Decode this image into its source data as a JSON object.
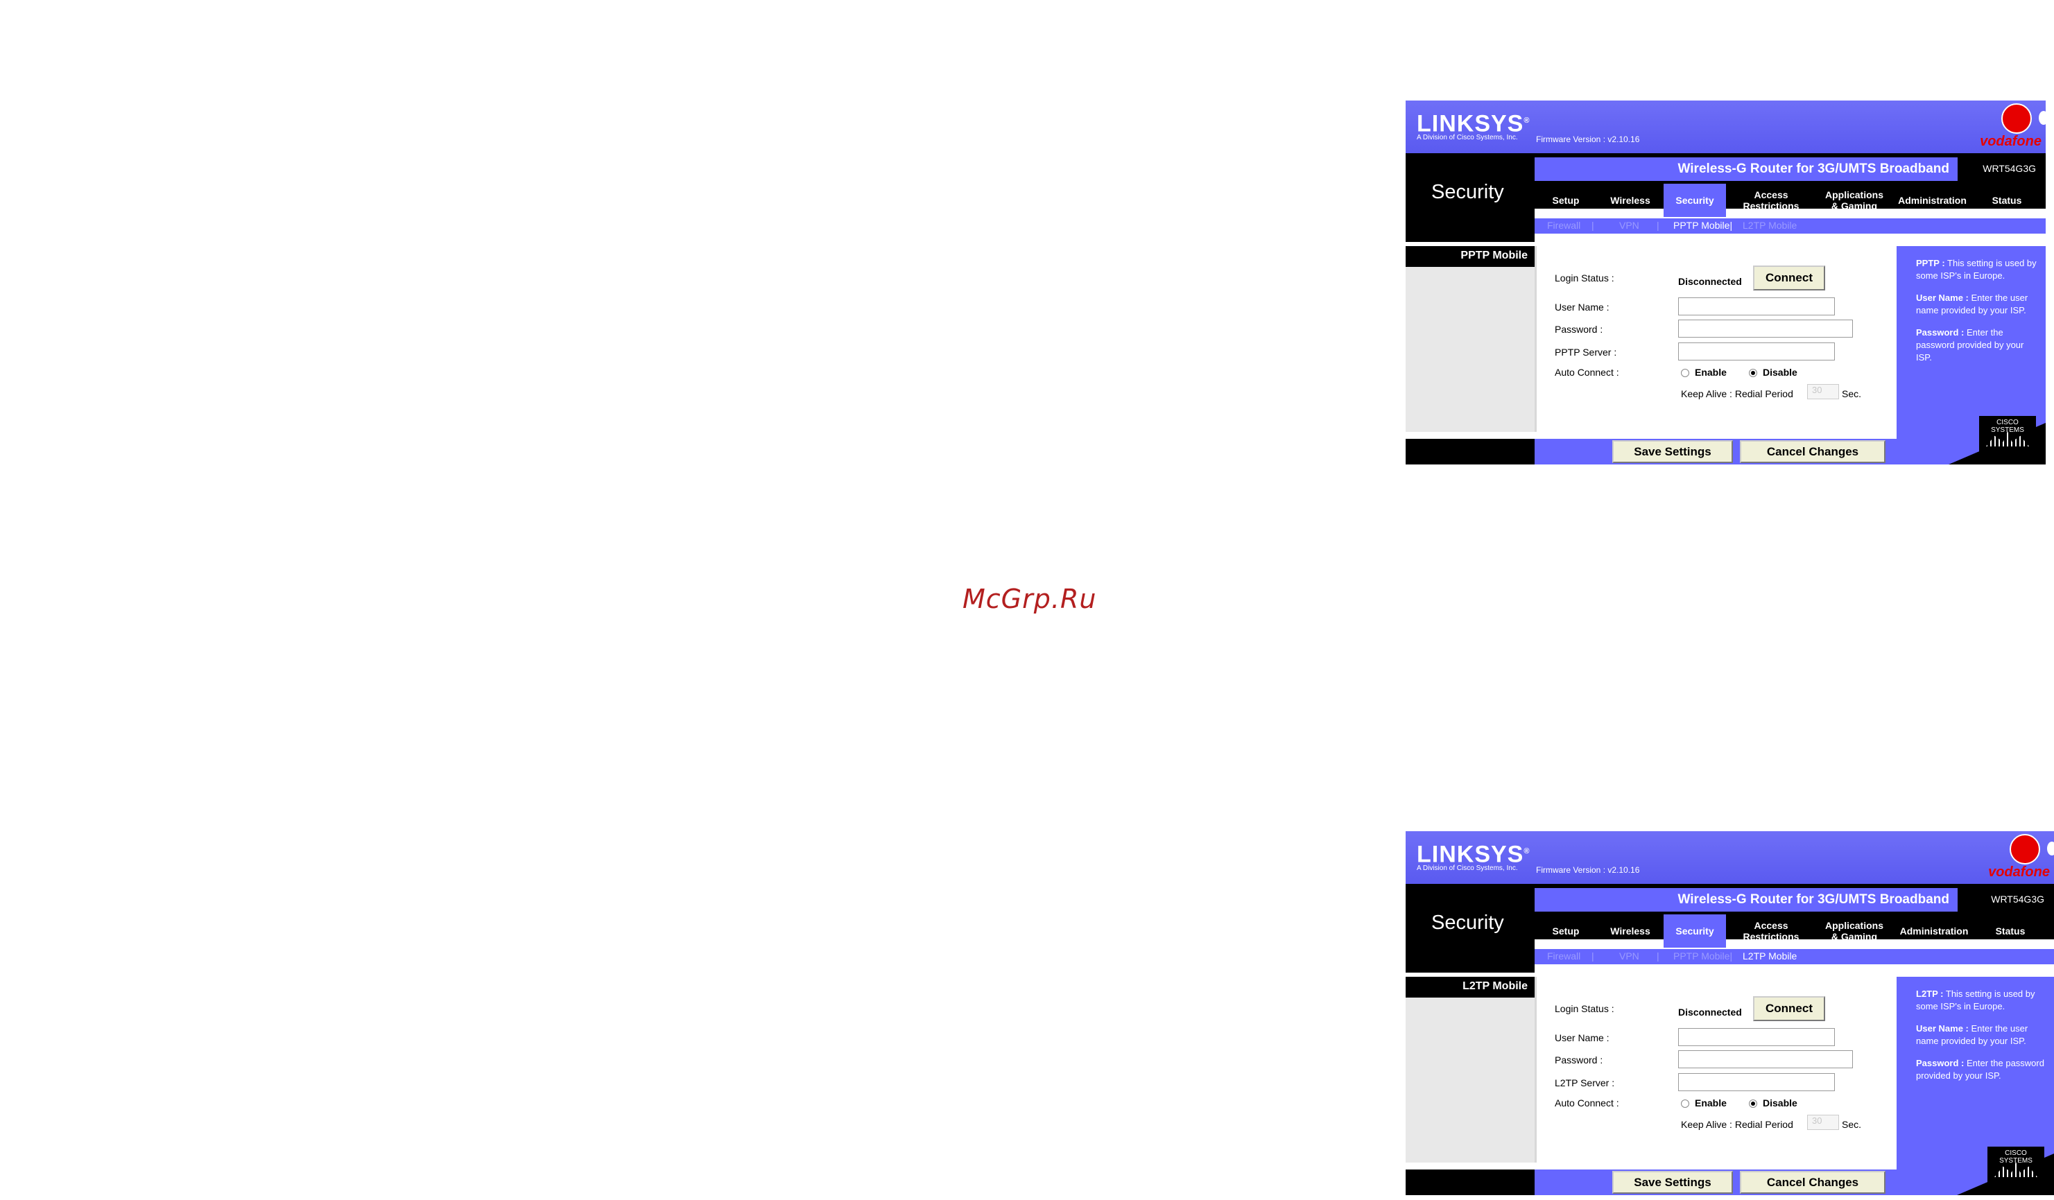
{
  "watermark": "McGrp.Ru",
  "panels": [
    {
      "brand": {
        "logo": "LINKSYS",
        "logo_mark": "®",
        "subtitle": "A Division of Cisco Systems, Inc.",
        "firmware": "Firmware Version : v2.10.16",
        "vodafone": "vodafone"
      },
      "page_title": "Security",
      "product_name": "Wireless-G Router for 3G/UMTS Broadband",
      "model": "WRT54G3G",
      "tabs": [
        {
          "label_line1": "Setup",
          "label_line2": ""
        },
        {
          "label_line1": "Wireless",
          "label_line2": ""
        },
        {
          "label_line1": "Security",
          "label_line2": ""
        },
        {
          "label_line1": "Access",
          "label_line2": "Restrictions"
        },
        {
          "label_line1": "Applications",
          "label_line2": "& Gaming"
        },
        {
          "label_line1": "Administration",
          "label_line2": ""
        },
        {
          "label_line1": "Status",
          "label_line2": ""
        }
      ],
      "subtabs": [
        "Firewall",
        "|",
        "VPN",
        "|",
        "PPTP Mobile|",
        "L2TP Mobile"
      ],
      "section_title": "PPTP Mobile",
      "form": {
        "login_status_label": "Login Status :",
        "login_status_value": "Disconnected",
        "connect_label": "Connect",
        "username_label": "User Name :",
        "password_label": "Password :",
        "server_label": "PPTP Server :",
        "auto_connect_label": "Auto Connect :",
        "enable_label": "Enable",
        "disable_label": "Disable",
        "keep_alive_label": "Keep Alive : Redial Period",
        "redial_value": "30",
        "sec_label": "Sec."
      },
      "help": {
        "p1_term": "PPTP :",
        "p1_text": " This setting is used by some ISP's in Europe.",
        "p2_term": "User Name :",
        "p2_text": " Enter the user name provided by your ISP.",
        "p3_term": "Password :",
        "p3_text": " Enter the password provided by your ISP.",
        "cisco": "CISCO SYSTEMS"
      },
      "buttons": {
        "save": "Save Settings",
        "cancel": "Cancel Changes"
      }
    },
    {
      "brand": {
        "logo": "LINKSYS",
        "logo_mark": "®",
        "subtitle": "A Division of Cisco Systems, Inc.",
        "firmware": "Firmware Version : v2.10.16",
        "vodafone": "vodafone"
      },
      "page_title": "Security",
      "product_name": "Wireless-G Router for 3G/UMTS Broadband",
      "model": "WRT54G3G",
      "tabs": [
        {
          "label_line1": "Setup",
          "label_line2": ""
        },
        {
          "label_line1": "Wireless",
          "label_line2": ""
        },
        {
          "label_line1": "Security",
          "label_line2": ""
        },
        {
          "label_line1": "Access",
          "label_line2": "Restrictions"
        },
        {
          "label_line1": "Applications",
          "label_line2": "& Gaming"
        },
        {
          "label_line1": "Administration",
          "label_line2": ""
        },
        {
          "label_line1": "Status",
          "label_line2": ""
        }
      ],
      "subtabs": [
        "Firewall",
        "|",
        "VPN",
        "|",
        "PPTP Mobile|",
        "L2TP Mobile"
      ],
      "section_title": "L2TP Mobile",
      "form": {
        "login_status_label": "Login Status :",
        "login_status_value": "Disconnected",
        "connect_label": "Connect",
        "username_label": "User Name :",
        "password_label": "Password :",
        "server_label": "L2TP Server :",
        "auto_connect_label": "Auto Connect :",
        "enable_label": "Enable",
        "disable_label": "Disable",
        "keep_alive_label": "Keep Alive : Redial Period",
        "redial_value": "30",
        "sec_label": "Sec."
      },
      "help": {
        "p1_term": "L2TP :",
        "p1_text": " This setting is used by some ISP's in Europe.",
        "p2_term": "User Name :",
        "p2_text": " Enter the user name provided by your ISP.",
        "p3_term": "Password :",
        "p3_text": " Enter the password provided by your ISP.",
        "cisco": "CISCO SYSTEMS"
      },
      "buttons": {
        "save": "Save Settings",
        "cancel": "Cancel Changes"
      }
    }
  ]
}
